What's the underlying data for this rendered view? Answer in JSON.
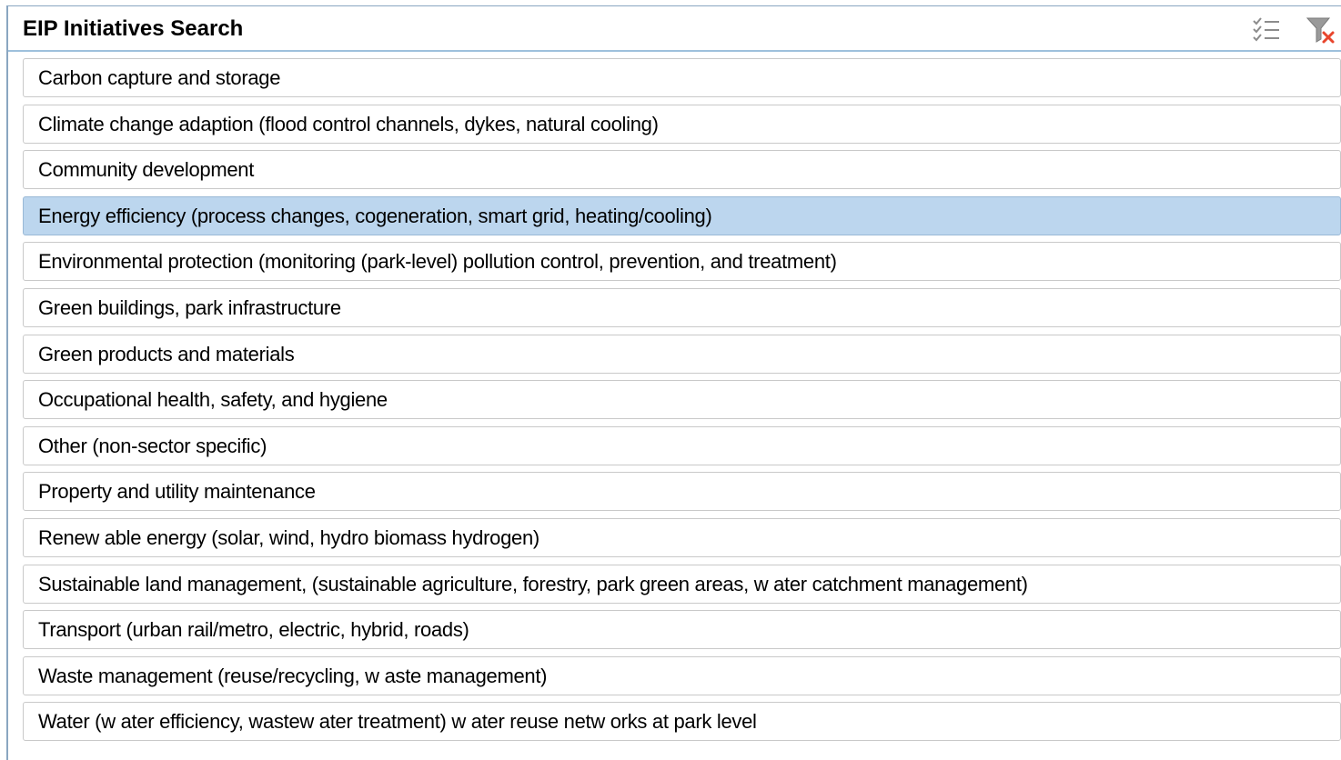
{
  "header": {
    "title": "EIP Initiatives Search",
    "multi_select_icon": "multi-select-list-icon",
    "clear_filter_icon": "clear-filter-icon"
  },
  "colors": {
    "selected_bg": "#bcd6ee",
    "header_border": "#9ec0dc",
    "clear_accent": "#e8452c"
  },
  "items": [
    {
      "label": "Carbon capture and storage",
      "selected": false
    },
    {
      "label": "Climate change adaption (flood control channels, dykes, natural cooling)",
      "selected": false
    },
    {
      "label": "Community development",
      "selected": false
    },
    {
      "label": "Energy efficiency (process changes, cogeneration, smart grid, heating/cooling)",
      "selected": true
    },
    {
      "label": "Environmental protection (monitoring (park-level) pollution control, prevention, and treatment)",
      "selected": false
    },
    {
      "label": "Green buildings, park infrastructure",
      "selected": false
    },
    {
      "label": "Green products and materials",
      "selected": false
    },
    {
      "label": "Occupational health, safety, and hygiene",
      "selected": false
    },
    {
      "label": "Other (non-sector specific)",
      "selected": false
    },
    {
      "label": "Property and utility maintenance",
      "selected": false
    },
    {
      "label": "Renew able energy (solar, wind, hydro biomass hydrogen)",
      "selected": false
    },
    {
      "label": "Sustainable land management, (sustainable agriculture, forestry, park green areas, w ater catchment management)",
      "selected": false
    },
    {
      "label": "Transport (urban rail/metro, electric, hybrid, roads)",
      "selected": false
    },
    {
      "label": "Waste management (reuse/recycling, w aste management)",
      "selected": false
    },
    {
      "label": "Water (w ater efficiency, wastew ater treatment) w ater reuse netw orks at park level",
      "selected": false
    }
  ]
}
